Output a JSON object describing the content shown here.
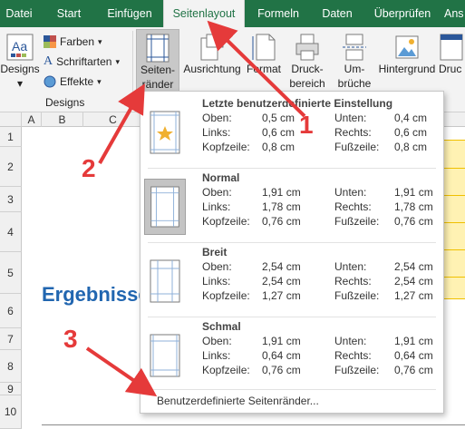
{
  "colors": {
    "excel_green": "#217346",
    "accent_blue": "#2166b0",
    "arrow_red": "#e53a3a",
    "highlight_yellow": "#fff2b3"
  },
  "tabs": [
    {
      "label": "Datei"
    },
    {
      "label": "Start"
    },
    {
      "label": "Einfügen"
    },
    {
      "label": "Seitenlayout"
    },
    {
      "label": "Formeln"
    },
    {
      "label": "Daten"
    },
    {
      "label": "Überprüfen"
    },
    {
      "label": "Ans"
    }
  ],
  "ribbon": {
    "themes": {
      "designs_label": "Designs",
      "colors_label": "Farben",
      "fonts_label": "Schriftarten",
      "effects_label": "Effekte",
      "group_label": "Designs"
    },
    "margins_label_1": "Seiten-",
    "margins_label_2": "ränder",
    "orientation_label": "Ausrichtung",
    "size_label": "Format",
    "print_area_label_1": "Druck-",
    "print_area_label_2": "bereich",
    "breaks_label_1": "Um-",
    "breaks_label_2": "brüche",
    "background_label": "Hintergrund",
    "print_titles_label": "Druc"
  },
  "sheet": {
    "columns": [
      "A",
      "B",
      "C"
    ],
    "rows": [
      "1",
      "2",
      "3",
      "4",
      "5",
      "6",
      "7",
      "8",
      "9",
      "10"
    ],
    "heading": "Ergebnisse"
  },
  "margin_options": [
    {
      "title": "Letzte benutzerdefinierte Einstellung",
      "values": [
        {
          "l1": "Oben:",
          "v1": "0,5 cm",
          "l2": "Unten:",
          "v2": "0,4 cm"
        },
        {
          "l1": "Links:",
          "v1": "0,6 cm",
          "l2": "Rechts:",
          "v2": "0,6 cm"
        },
        {
          "l1": "Kopfzeile:",
          "v1": "0,8 cm",
          "l2": "Fußzeile:",
          "v2": "0,8 cm"
        }
      ]
    },
    {
      "title": "Normal",
      "values": [
        {
          "l1": "Oben:",
          "v1": "1,91 cm",
          "l2": "Unten:",
          "v2": "1,91 cm"
        },
        {
          "l1": "Links:",
          "v1": "1,78 cm",
          "l2": "Rechts:",
          "v2": "1,78 cm"
        },
        {
          "l1": "Kopfzeile:",
          "v1": "0,76 cm",
          "l2": "Fußzeile:",
          "v2": "0,76 cm"
        }
      ]
    },
    {
      "title": "Breit",
      "values": [
        {
          "l1": "Oben:",
          "v1": "2,54 cm",
          "l2": "Unten:",
          "v2": "2,54 cm"
        },
        {
          "l1": "Links:",
          "v1": "2,54 cm",
          "l2": "Rechts:",
          "v2": "2,54 cm"
        },
        {
          "l1": "Kopfzeile:",
          "v1": "1,27 cm",
          "l2": "Fußzeile:",
          "v2": "1,27 cm"
        }
      ]
    },
    {
      "title": "Schmal",
      "values": [
        {
          "l1": "Oben:",
          "v1": "1,91 cm",
          "l2": "Unten:",
          "v2": "1,91 cm"
        },
        {
          "l1": "Links:",
          "v1": "0,64 cm",
          "l2": "Rechts:",
          "v2": "0,64 cm"
        },
        {
          "l1": "Kopfzeile:",
          "v1": "0,76 cm",
          "l2": "Fußzeile:",
          "v2": "0,76 cm"
        }
      ]
    }
  ],
  "custom_margins_label": "Benutzerdefinierte Seitenränder...",
  "annotations": {
    "n1": "1",
    "n2": "2",
    "n3": "3"
  }
}
